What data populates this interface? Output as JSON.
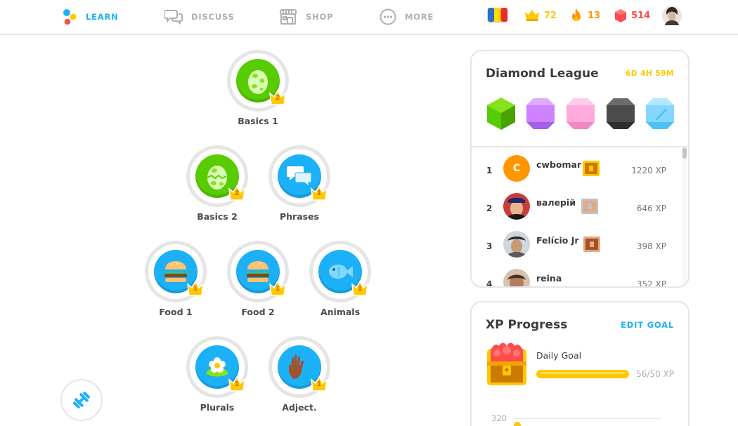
{
  "nav": {
    "learn": "LEARN",
    "discuss": "DISCUSS",
    "shop": "SHOP",
    "more": "MORE"
  },
  "stats": {
    "crowns": "72",
    "streak": "13",
    "gems": "514"
  },
  "skills": [
    {
      "label": "Basics 1",
      "level": "2"
    },
    {
      "label": "Basics 2",
      "level": "2"
    },
    {
      "label": "Phrases",
      "level": "1"
    },
    {
      "label": "Food 1",
      "level": "1"
    },
    {
      "label": "Food 2",
      "level": "1"
    },
    {
      "label": "Animals",
      "level": "1"
    },
    {
      "label": "Plurals",
      "level": "1"
    },
    {
      "label": "Adject.",
      "level": "1"
    }
  ],
  "league": {
    "title": "Diamond League",
    "timer": "6D 4H 59M",
    "leaderboard": [
      {
        "rank": "1",
        "initial": "C",
        "name": "cwbomar",
        "xp": "1220 XP"
      },
      {
        "rank": "2",
        "name": "валерій",
        "xp": "646 XP"
      },
      {
        "rank": "3",
        "name": "Felício Jr",
        "xp": "398 XP"
      },
      {
        "rank": "4",
        "name": "reina",
        "xp": "352 XP"
      }
    ]
  },
  "xp_progress": {
    "title": "XP Progress",
    "edit_goal": "EDIT GOAL",
    "daily_goal_label": "Daily Goal",
    "value_text": "56/50 XP",
    "fraction": 1.0,
    "chart_tick": "320"
  },
  "colors": {
    "accent": "#1cb0f6",
    "green": "#58cc02",
    "gold": "#ffc800",
    "streak": "#ff9600",
    "gem": "#ff4b4b"
  }
}
